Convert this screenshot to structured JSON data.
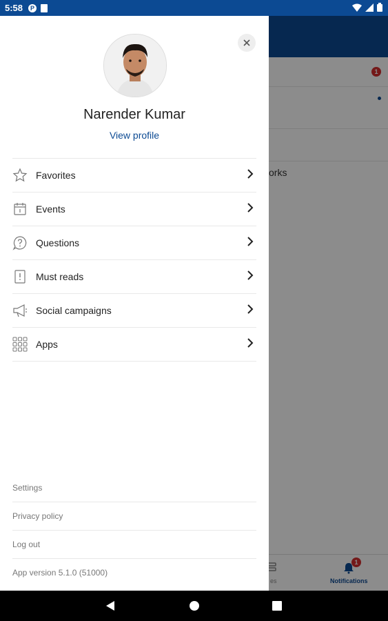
{
  "status_bar": {
    "time": "5:58"
  },
  "drawer": {
    "user": {
      "name": "Narender Kumar",
      "view_profile": "View profile"
    },
    "menu": [
      {
        "label": "Favorites",
        "icon": "star-icon"
      },
      {
        "label": "Events",
        "icon": "calendar-icon"
      },
      {
        "label": "Questions",
        "icon": "question-icon"
      },
      {
        "label": "Must reads",
        "icon": "must-read-icon"
      },
      {
        "label": "Social campaigns",
        "icon": "megaphone-icon"
      },
      {
        "label": "Apps",
        "icon": "apps-grid-icon"
      }
    ],
    "footer": {
      "settings": "Settings",
      "privacy": "Privacy policy",
      "logout": "Log out",
      "version": "App version 5.1.0 (51000)"
    }
  },
  "background": {
    "partial_text": "orks",
    "notifications_badge": "1",
    "tab_notifications_badge": "1",
    "tab_notifications_label": "Notifications",
    "tab_partial_label": "es"
  },
  "colors": {
    "brand": "#0c4a93",
    "badge": "#d32f2f"
  }
}
